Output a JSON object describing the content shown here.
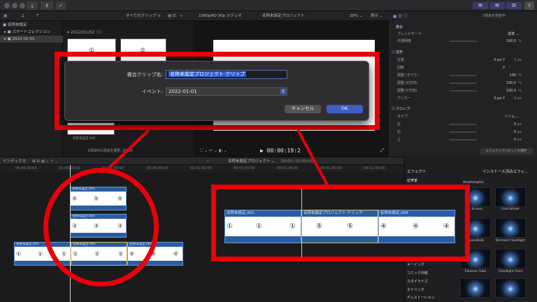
{
  "toolbar": {
    "import_icon": "download-icon",
    "keyword_icon": "key-icon",
    "check_icon": "check-icon"
  },
  "browser_header": {
    "filter": "すべてのクリップ ≎",
    "viewer_format": "1080pHD 30p ステレオ",
    "project": "名称未設定プロジェクト",
    "zoom": "20% ⌄",
    "view": "表示 ⌄",
    "inspector_selection": "3項目を検査中"
  },
  "sidebar": {
    "library": "名称未設定",
    "items": [
      "スマートコレクション",
      "2022-01-01"
    ]
  },
  "browser": {
    "date_header": "2022/01/02",
    "count": "(5)",
    "clip_caption": "名称未設定.005",
    "selection_info": "6項目中1項目を選択, 01:30"
  },
  "viewer": {
    "timecode": "00:00:19:2"
  },
  "inspector": {
    "sections": [
      {
        "title": "複合",
        "rows": [
          {
            "label": "ブレンドモード",
            "value": "標準 ⌄"
          },
          {
            "label": "不透明度",
            "value": "100.0",
            "unit": "%"
          }
        ]
      },
      {
        "title": "変形",
        "rows": [
          {
            "label": "位置",
            "value": "0 px  Y",
            "unit": "0 px"
          },
          {
            "label": "回転",
            "value": "0",
            "unit": "°"
          },
          {
            "label": "調整 (すべて)",
            "value": "130",
            "unit": "%"
          },
          {
            "label": "調整 (X方向)",
            "value": "100.0",
            "unit": "%"
          },
          {
            "label": "調整 (Y方向)",
            "value": "100.0",
            "unit": "%"
          },
          {
            "label": "アンカー",
            "value": "0 px  Y",
            "unit": "0 px"
          }
        ]
      },
      {
        "title": "クロップ",
        "rows": [
          {
            "label": "タイプ",
            "value": "トリム ⌄"
          },
          {
            "label": "左",
            "value": "0",
            "unit": "px"
          },
          {
            "label": "右",
            "value": "0",
            "unit": "px"
          },
          {
            "label": "上",
            "value": "0",
            "unit": "px"
          }
        ]
      }
    ],
    "save_preset": "エフェクトプリセットを保存"
  },
  "timeline": {
    "index": "インデックス",
    "project": "名称未設定プロジェクト",
    "duration": "20:02 / 01:00:00",
    "ticks": [
      "00:00:00:00",
      "00:00:15:00",
      "00:00:30:00",
      "00:00:45:00",
      "00:01:00:00",
      "00:01:15:00",
      "00:01:30:00",
      "00:01:45:00",
      "00:02:00:00"
    ],
    "clips": {
      "top": "名称未設定.005",
      "middle": "名称未設定.003",
      "main_left": "名称未設定.001",
      "main_right": "名称未設定.004"
    },
    "zoom_clips": {
      "left": "名称未設定.001",
      "compound": "名称未設定プロジェクト クリップ",
      "right": "名称未設定.004"
    },
    "glyphs": {
      "one": "①",
      "two": "②",
      "three": "③",
      "four": "④",
      "five": "⑤"
    }
  },
  "effects": {
    "title": "エフェクト",
    "installed": "インストール済みエフェ…",
    "categories": [
      "ビデオ",
      "キーイング",
      "コミック外観",
      "スタイライズ",
      "タイリング",
      "ディストーション"
    ],
    "group": "Anamorphic",
    "tiles": [
      "...Screen",
      "Cold Winter",
      "...oomBulb",
      "Dimmed Floodlight",
      "Electron Tube",
      "Floodlight Flare"
    ]
  },
  "dialog": {
    "name_label": "複合クリップ名:",
    "name_value": "名称未設定プロジェクト クリップ",
    "event_label": "イベント:",
    "event_value": "2022-01-01",
    "cancel": "キャンセル",
    "ok": "OK"
  },
  "colors": {
    "annotation_red": "#e8000b",
    "clip_blue": "#2a5ca0",
    "compound_yellow": "#d8c24a",
    "ok_blue": "#3f5fc8"
  }
}
